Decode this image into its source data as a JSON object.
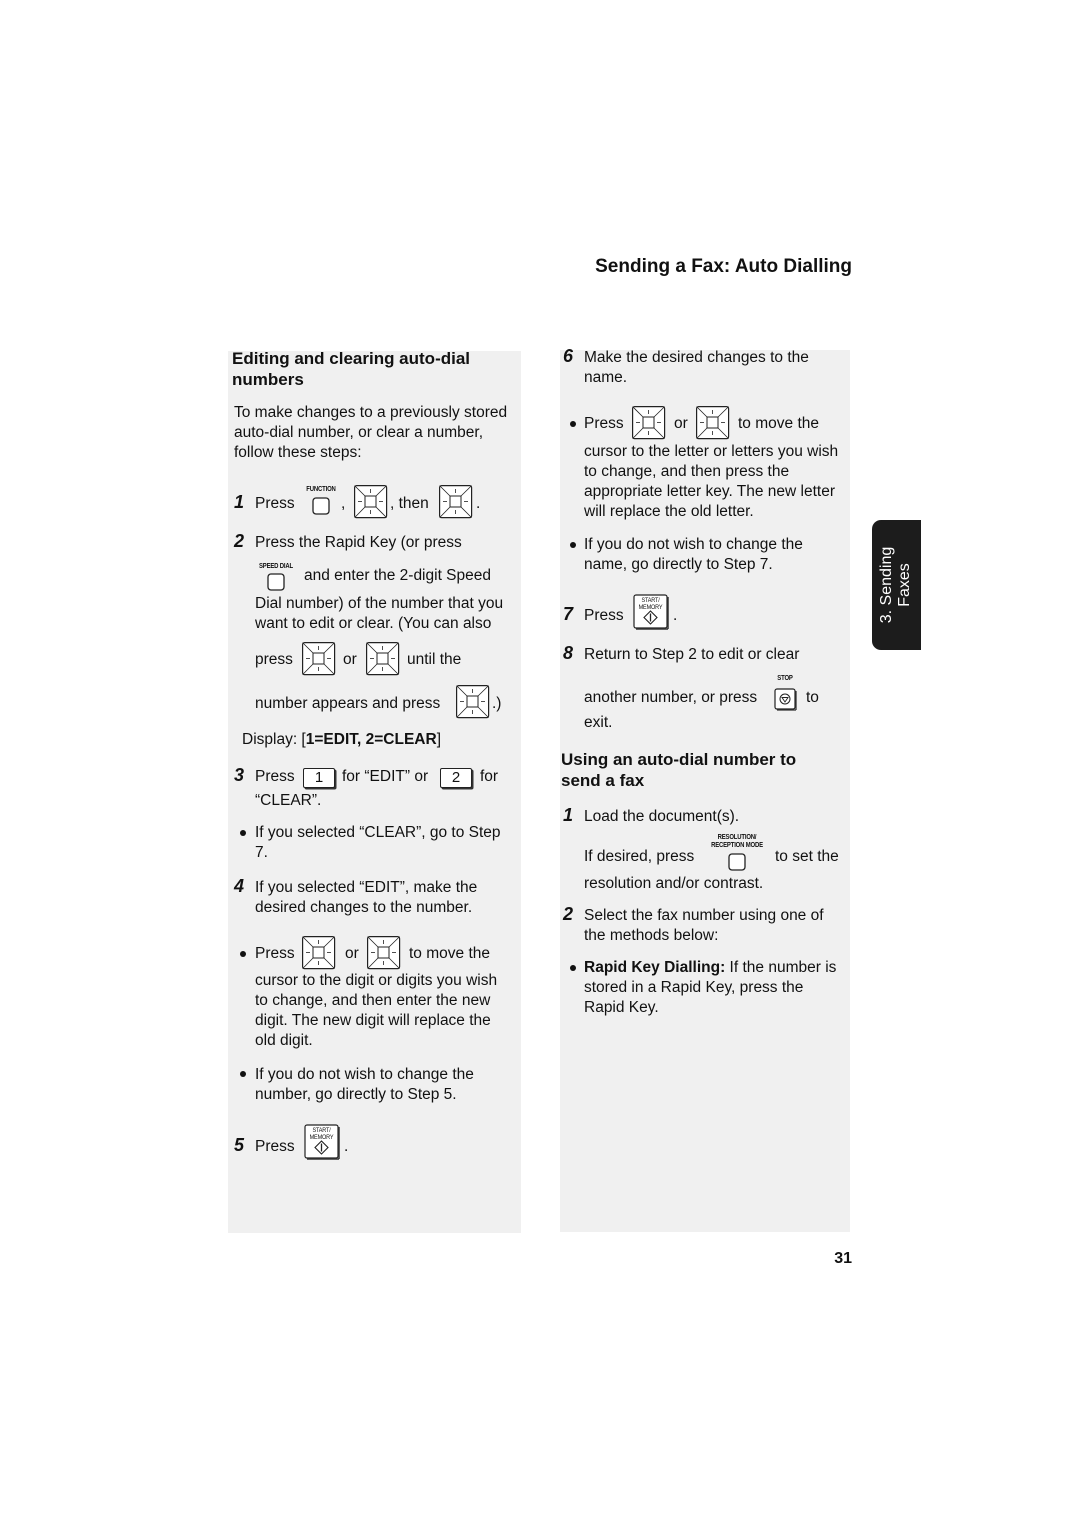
{
  "header": {
    "title": "Sending a Fax: Auto Dialling"
  },
  "side_tab": {
    "line1": "3. Sending",
    "line2": "Faxes"
  },
  "page_number": "31",
  "left_column": {
    "heading": [
      "Editing and clearing auto-dial",
      "numbers"
    ],
    "intro": [
      "To make changes to a previously stored",
      "auto-dial number, or clear a number,",
      "follow these steps:"
    ],
    "step1": {
      "num": "1",
      "press": "Press",
      "comma": ",",
      "then": ", then",
      "period": ".",
      "key_function_label": "FUNCTION"
    },
    "step2": {
      "num": "2",
      "lines": [
        "Press the Rapid Key (or press",
        "and enter the 2-digit Speed",
        "Dial number) of the number that you",
        "want to edit or clear. (You can also"
      ],
      "press": "press",
      "or": "or",
      "until": "until the",
      "number_appears": "number appears and press",
      "close": ".)",
      "key_speed_dial_label": "SPEED DIAL"
    },
    "display": {
      "prefix": "Display: [",
      "value": "1=EDIT, 2=CLEAR",
      "suffix": "]"
    },
    "step3": {
      "num": "3",
      "press": "Press",
      "key1": "1",
      "for_edit": "for “EDIT” or",
      "key2": "2",
      "for": "for",
      "clear": "“CLEAR”."
    },
    "bullet_clear": [
      "If you selected “CLEAR”, go to Step",
      "7."
    ],
    "step4": {
      "num": "4",
      "lines": [
        "If you selected “EDIT”, make the",
        "desired changes to the number."
      ]
    },
    "bullet_move": {
      "press": "Press",
      "or": "or",
      "to_move": "to move the",
      "lines": [
        "cursor to the digit or digits you wish",
        "to change, and then enter the new",
        "digit. The new digit will replace the",
        "old digit."
      ]
    },
    "bullet_skip": [
      "If you do not wish to change the",
      "number, go directly to Step 5."
    ],
    "step5": {
      "num": "5",
      "press": "Press",
      "period": ".",
      "key_label_1": "START/",
      "key_label_2": "MEMORY"
    }
  },
  "right_column": {
    "step6": {
      "num": "6",
      "lines": [
        "Make the desired changes to the",
        "name."
      ]
    },
    "bullet_move": {
      "press": "Press",
      "or": "or",
      "to_move": "to move the",
      "lines": [
        "cursor to the letter or letters you wish",
        "to change, and then press the",
        "appropriate letter key. The new letter",
        "will replace the old letter."
      ]
    },
    "bullet_skip": [
      "If you do not wish to change the",
      "name, go directly to Step 7."
    ],
    "step7": {
      "num": "7",
      "press": "Press",
      "period": ".",
      "key_label_1": "START/",
      "key_label_2": "MEMORY"
    },
    "step8": {
      "num": "8",
      "line1": "Return to Step 2 to edit or clear",
      "line2": "another number, or press",
      "to": "to",
      "line3": "exit.",
      "key_stop_label": "STOP"
    },
    "heading2": [
      "Using an auto-dial number to",
      "send a fax"
    ],
    "s2_step1": {
      "num": "1",
      "line1": "Load the document(s).",
      "if_desired": "If desired, press",
      "to_set": "to set the",
      "line3": "resolution and/or contrast.",
      "key_label_1": "RESOLUTION/",
      "key_label_2": "RECEPTION MODE"
    },
    "s2_step2": {
      "num": "2",
      "lines": [
        "Select the fax number using one of",
        "the methods below:"
      ]
    },
    "bullet_rapid": {
      "bold": "Rapid Key Dialling:",
      "rest": " If the number is",
      "lines": [
        "stored in a Rapid Key, press the",
        "Rapid Key."
      ]
    }
  }
}
